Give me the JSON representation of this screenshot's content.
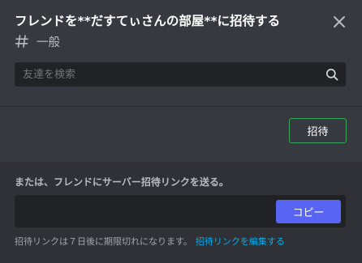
{
  "dialog": {
    "title": "フレンドを**だすてぃさんの部屋**に招待する",
    "channel_name": "一般"
  },
  "search": {
    "placeholder": "友達を検索",
    "value": ""
  },
  "invite": {
    "button_label": "招待"
  },
  "link_section": {
    "label": "または、フレンドにサーバー招待リンクを送る。",
    "link_value": "",
    "copy_label": "コピー",
    "expire_text": "招待リンクは７日後に期限切れになります。",
    "edit_link_label": "招待リンクを編集する"
  },
  "icons": {
    "close": "close-icon",
    "channel": "hash-icon",
    "search": "search-icon"
  },
  "colors": {
    "background": "#36393f",
    "footer_background": "#2f3136",
    "input_background": "#202225",
    "invite_border": "#3ba55c",
    "copy_button": "#5865f2",
    "link_color": "#00aff4"
  }
}
